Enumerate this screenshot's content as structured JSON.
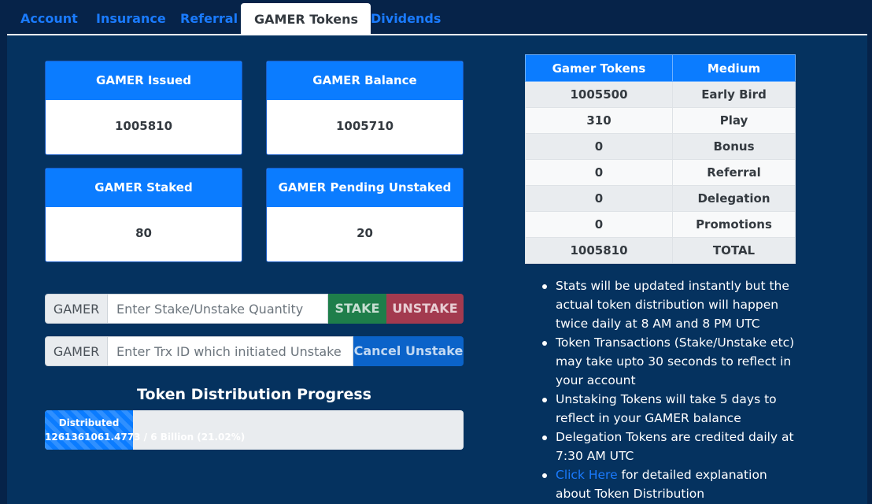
{
  "tabs": [
    {
      "label": "Account"
    },
    {
      "label": "Insurance"
    },
    {
      "label": "Referral"
    },
    {
      "label": "GAMER Tokens"
    },
    {
      "label": "Dividends"
    }
  ],
  "cards": {
    "issued": {
      "title": "GAMER Issued",
      "value": "1005810"
    },
    "balance": {
      "title": "GAMER Balance",
      "value": "1005710"
    },
    "staked": {
      "title": "GAMER Staked",
      "value": "80"
    },
    "pending": {
      "title": "GAMER Pending Unstaked",
      "value": "20"
    }
  },
  "stake_form": {
    "prefix": "GAMER",
    "placeholder": "Enter Stake/Unstake Quantity",
    "stake_label": "STAKE",
    "unstake_label": "UNSTAKE"
  },
  "cancel_form": {
    "prefix": "GAMER",
    "placeholder": "Enter Trx ID which initiated Unstake",
    "cancel_label": "Cancel Unstake"
  },
  "progress": {
    "title": "Token Distribution Progress",
    "label": "Distributed",
    "detail": "1261361061.4773 / 6 Billion (21.02%)",
    "fraction": 0.2102
  },
  "token_table": {
    "headers": [
      "Gamer Tokens",
      "Medium"
    ],
    "rows": [
      [
        "1005500",
        "Early Bird"
      ],
      [
        "310",
        "Play"
      ],
      [
        "0",
        "Bonus"
      ],
      [
        "0",
        "Referral"
      ],
      [
        "0",
        "Delegation"
      ],
      [
        "0",
        "Promotions"
      ],
      [
        "1005810",
        "TOTAL"
      ]
    ]
  },
  "notes": {
    "n1": "Stats will be updated instantly but the actual token distribution will happen twice daily at 8 AM and 8 PM UTC",
    "n2": "Token Transactions (Stake/Unstake etc) may take upto 30 seconds to reflect in your account",
    "n3": "Unstaking Tokens will take 5 days to reflect in your GAMER balance",
    "n4": "Delegation Tokens are credited daily at 7:30 AM UTC",
    "n5_link": "Click Here",
    "n5_text": " for detailed explanation about Token Distribution"
  },
  "colors": {
    "page_bg": "#062349",
    "panel_bg": "#05325f",
    "primary": "#0b7cff",
    "stake_btn": "#1e7e4a",
    "unstake_btn": "#a33a4f",
    "cancel_btn": "#0b63c9",
    "link": "#1a7bff"
  }
}
